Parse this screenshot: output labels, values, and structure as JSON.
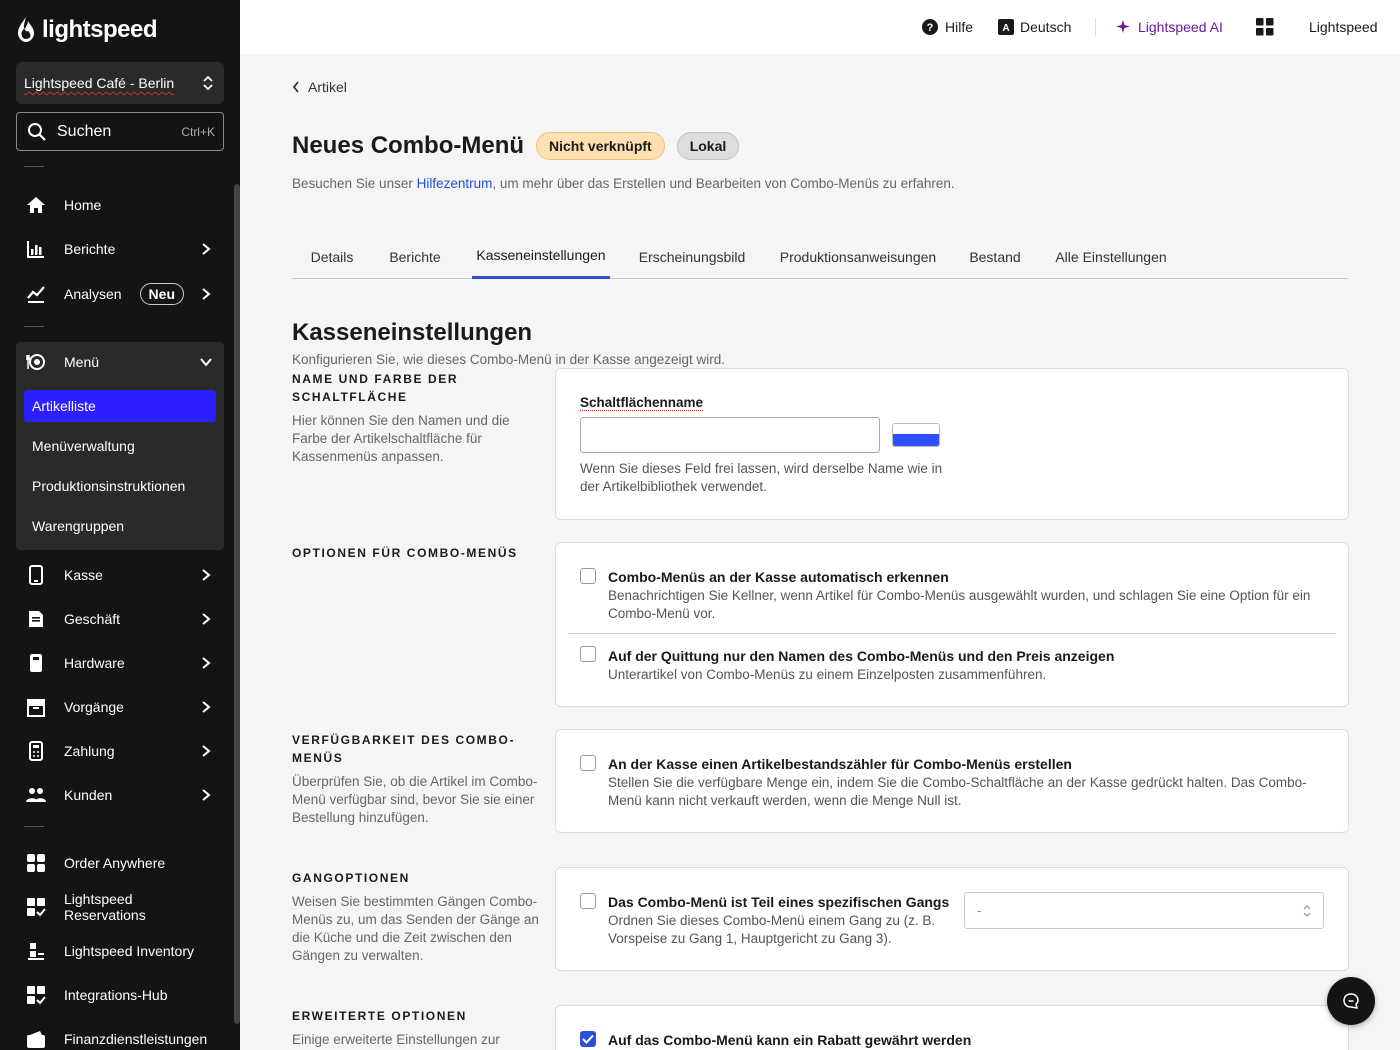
{
  "sidebar": {
    "logo_text": "lightspeed",
    "location": "Lightspeed Café - Berlin",
    "search": {
      "label": "Suchen",
      "shortcut": "Ctrl+K"
    },
    "nav": [
      {
        "label": "Home",
        "icon": "home-icon"
      },
      {
        "label": "Berichte",
        "icon": "reports-icon"
      },
      {
        "label": "Analysen",
        "icon": "analytics-icon",
        "badge": "Neu"
      },
      {
        "label": "Menü",
        "icon": "menu-icon"
      }
    ],
    "submenu": [
      {
        "label": "Artikelliste",
        "active": true
      },
      {
        "label": "Menüverwaltung"
      },
      {
        "label": "Produktionsinstruktionen"
      },
      {
        "label": "Warengruppen"
      }
    ],
    "nav2": [
      {
        "label": "Kasse",
        "icon": "pos-icon"
      },
      {
        "label": "Geschäft",
        "icon": "business-icon"
      },
      {
        "label": "Hardware",
        "icon": "hardware-icon"
      },
      {
        "label": "Vorgänge",
        "icon": "transactions-icon"
      },
      {
        "label": "Zahlung",
        "icon": "payment-icon"
      },
      {
        "label": "Kunden",
        "icon": "customers-icon"
      }
    ],
    "nav3": [
      {
        "label": "Order Anywhere",
        "icon": "order-anywhere-icon"
      },
      {
        "label": "Lightspeed Reservations",
        "icon": "reservations-icon"
      },
      {
        "label": "Lightspeed Inventory",
        "icon": "inventory-icon"
      },
      {
        "label": "Integrations-Hub",
        "icon": "integrations-icon"
      },
      {
        "label": "Finanzdienstleistungen",
        "icon": "financial-icon"
      }
    ]
  },
  "topbar": {
    "help": "Hilfe",
    "language": "Deutsch",
    "ai": "Lightspeed AI",
    "account": "Lightspeed"
  },
  "page": {
    "back_label": "Artikel",
    "title": "Neues Combo-Menü",
    "badge_status": "Nicht verknüpft",
    "badge_scope": "Lokal",
    "subtitle_pre": "Besuchen Sie unser ",
    "subtitle_link": "Hilfezentrum",
    "subtitle_post": ", um mehr über das Erstellen und Bearbeiten von Combo-Menüs zu erfahren.",
    "tabs": [
      "Details",
      "Berichte",
      "Kasseneinstellungen",
      "Erscheinungsbild",
      "Produktionsanweisungen",
      "Bestand",
      "Alle Einstellungen"
    ],
    "active_tab": "Kasseneinstellungen"
  },
  "section": {
    "title": "Kasseneinstellungen",
    "subtitle": "Konfigurieren Sie, wie dieses Combo-Menü in der Kasse angezeigt wird."
  },
  "groups": {
    "name_color": {
      "heading": "NAME UND FARBE DER SCHALTFLÄCHE",
      "description": "Hier können Sie den Namen und die Farbe der Artikelschaltfläche für Kassenmenüs anpassen.",
      "field_label": "Schaltflächenname",
      "field_value": "",
      "swatch_color": "#2d4fff",
      "help": "Wenn Sie dieses Feld frei lassen, wird derselbe Name wie in der Artikelbibliothek verwendet."
    },
    "combo_options": {
      "heading": "OPTIONEN FÜR COMBO-MENÜS",
      "options": [
        {
          "title": "Combo-Menüs an der Kasse automatisch erkennen",
          "desc": "Benachrichtigen Sie Kellner, wenn Artikel für Combo-Menüs ausgewählt wurden, und schlagen Sie eine Option für ein Combo-Menü vor.",
          "checked": false
        },
        {
          "title": "Auf der Quittung nur den Namen des Combo-Menüs und den Preis anzeigen",
          "desc": "Unterartikel von Combo-Menüs zu einem Einzelposten zusammenführen.",
          "checked": false
        }
      ]
    },
    "availability": {
      "heading": "VERFÜGBARKEIT DES COMBO-MENÜS",
      "description": "Überprüfen Sie, ob die Artikel im Combo-Menü verfügbar sind, bevor Sie sie einer Bestellung hinzufügen.",
      "option": {
        "title": "An der Kasse einen Artikelbestandszähler für Combo-Menüs erstellen",
        "desc": "Stellen Sie die verfügbare Menge ein, indem Sie die Combo-Schaltfläche an der Kasse gedrückt halten. Das Combo-Menü kann nicht verkauft werden, wenn die Menge Null ist.",
        "checked": false
      }
    },
    "courses": {
      "heading": "GANGOPTIONEN",
      "description": "Weisen Sie bestimmten Gängen Combo-Menüs zu, um das Senden der Gänge an die Küche und die Zeit zwischen den Gängen zu verwalten.",
      "option": {
        "title": "Das Combo-Menü ist Teil eines spezifischen Gangs",
        "desc": "Ordnen Sie dieses Combo-Menü einem Gang zu (z. B. Vorspeise zu Gang 1, Hauptgericht zu Gang 3).",
        "checked": false
      },
      "select_value": "-"
    },
    "advanced": {
      "heading": "ERWEITERTE OPTIONEN",
      "description": "Einige erweiterte Einstellungen zur",
      "option": {
        "title": "Auf das Combo-Menü kann ein Rabatt gewährt werden",
        "checked": true
      }
    }
  },
  "colors": {
    "accent": "#2d4fd8",
    "sidebar_bg": "#141414",
    "active_item": "#2d1fff",
    "ai": "#6a1b9a"
  }
}
